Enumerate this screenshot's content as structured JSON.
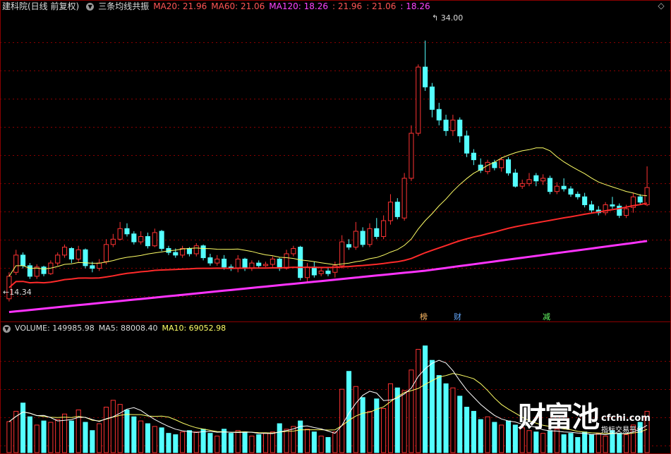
{
  "header": {
    "stock": "建科院(日线 前复权)",
    "indicator": "三条均线共振",
    "ma20": "MA20: 21.96",
    "ma60": "MA60: 21.06",
    "ma120": "MA120: 18.26",
    "v1": ": 21.96",
    "v2": ": 21.06",
    "v3": ": 18.26",
    "close_glyph": "◇"
  },
  "volume_header": {
    "volume": "VOLUME: 149985.98",
    "ma5": "MA5: 88008.40",
    "ma10": "MA10: 69052.98"
  },
  "labels": {
    "high": "34.00",
    "low": "14.34",
    "tag_bang": "榜",
    "tag_cai": "财",
    "tag_jian": "减"
  },
  "watermark": {
    "brand": "财富池",
    "site": "cfchi.com",
    "slogan": "指标交易平台"
  },
  "colors": {
    "up": "#ff3333",
    "down": "#54ffff",
    "ma20": "#ffff66",
    "ma60": "#ff2a2a",
    "ma120": "#ff33ff",
    "grid": "#8b0000"
  },
  "chart_data": {
    "type": "candlestick",
    "price_axis": {
      "min": 13,
      "max": 36
    },
    "annotations": {
      "max": 34.0,
      "min": 14.34
    },
    "candles": [
      [
        14.5,
        16.2,
        16.5,
        14.3
      ],
      [
        16.5,
        17.8,
        18.2,
        16.3
      ],
      [
        17.8,
        17.0,
        18.0,
        16.8
      ],
      [
        17.0,
        16.2,
        17.2,
        16.0
      ],
      [
        16.2,
        16.9,
        17.1,
        16.0
      ],
      [
        16.9,
        16.4,
        17.0,
        16.2
      ],
      [
        16.4,
        17.2,
        17.4,
        16.3
      ],
      [
        17.2,
        17.8,
        18.0,
        17.0
      ],
      [
        17.8,
        18.4,
        18.6,
        17.6
      ],
      [
        18.3,
        17.5,
        18.4,
        17.2
      ],
      [
        17.5,
        18.2,
        18.5,
        17.3
      ],
      [
        18.2,
        17.0,
        18.3,
        16.8
      ],
      [
        17.0,
        16.8,
        17.3,
        16.5
      ],
      [
        16.8,
        17.2,
        17.5,
        16.6
      ],
      [
        17.3,
        18.6,
        19.0,
        17.1
      ],
      [
        18.6,
        19.0,
        19.4,
        18.4
      ],
      [
        19.0,
        19.8,
        20.3,
        18.9
      ],
      [
        19.8,
        19.4,
        20.2,
        19.2
      ],
      [
        19.4,
        18.8,
        19.6,
        18.6
      ],
      [
        18.8,
        19.2,
        19.6,
        18.6
      ],
      [
        19.2,
        18.5,
        19.5,
        18.3
      ],
      [
        18.5,
        19.5,
        19.8,
        18.4
      ],
      [
        19.6,
        18.3,
        19.7,
        18.1
      ],
      [
        18.3,
        18.0,
        18.5,
        17.8
      ],
      [
        18.0,
        17.8,
        18.3,
        17.6
      ],
      [
        17.8,
        18.3,
        18.5,
        17.6
      ],
      [
        18.3,
        17.9,
        18.4,
        17.7
      ],
      [
        17.9,
        18.5,
        18.7,
        17.7
      ],
      [
        18.5,
        17.6,
        18.6,
        17.4
      ],
      [
        17.6,
        17.2,
        17.9,
        17.0
      ],
      [
        17.2,
        17.5,
        17.8,
        17.0
      ],
      [
        17.5,
        16.9,
        17.8,
        16.7
      ],
      [
        16.9,
        16.8,
        17.1,
        16.6
      ],
      [
        16.8,
        17.5,
        17.8,
        16.5
      ],
      [
        17.5,
        16.8,
        17.6,
        16.6
      ],
      [
        16.8,
        17.2,
        17.4,
        16.6
      ],
      [
        17.2,
        17.0,
        17.4,
        16.8
      ],
      [
        17.0,
        17.1,
        17.3,
        16.9
      ],
      [
        17.1,
        17.5,
        17.7,
        16.9
      ],
      [
        17.5,
        16.8,
        17.6,
        16.6
      ],
      [
        16.8,
        17.9,
        18.2,
        16.7
      ],
      [
        17.9,
        18.3,
        18.5,
        17.7
      ],
      [
        18.4,
        16.1,
        18.5,
        15.9
      ],
      [
        16.1,
        16.9,
        17.2,
        15.8
      ],
      [
        16.9,
        16.3,
        17.3,
        16.1
      ],
      [
        16.4,
        16.6,
        16.9,
        16.2
      ],
      [
        16.6,
        16.4,
        16.9,
        16.2
      ],
      [
        16.5,
        17.0,
        17.3,
        16.1
      ],
      [
        17.0,
        18.8,
        19.3,
        16.8
      ],
      [
        18.6,
        18.4,
        19.0,
        18.2
      ],
      [
        18.4,
        19.6,
        20.3,
        18.2
      ],
      [
        19.6,
        18.6,
        19.9,
        18.4
      ],
      [
        18.6,
        19.8,
        20.2,
        18.4
      ],
      [
        19.8,
        19.2,
        20.6,
        19.0
      ],
      [
        19.2,
        20.4,
        20.8,
        19.0
      ],
      [
        20.4,
        21.8,
        22.4,
        20.1
      ],
      [
        21.8,
        20.7,
        22.1,
        20.5
      ],
      [
        20.6,
        23.6,
        24.0,
        20.4
      ],
      [
        23.6,
        27.0,
        27.6,
        23.4
      ],
      [
        27.0,
        32.0,
        32.2,
        26.8
      ],
      [
        32.0,
        30.5,
        34.0,
        30.2
      ],
      [
        30.5,
        28.8,
        30.8,
        28.2
      ],
      [
        28.8,
        28.0,
        29.3,
        27.6
      ],
      [
        28.0,
        27.2,
        28.4,
        26.8
      ],
      [
        27.2,
        28.0,
        28.4,
        26.8
      ],
      [
        28.0,
        26.8,
        28.2,
        26.3
      ],
      [
        26.8,
        25.5,
        27.2,
        25.2
      ],
      [
        25.5,
        25.0,
        25.8,
        24.6
      ],
      [
        24.6,
        24.2,
        25.1,
        24.0
      ],
      [
        24.1,
        24.8,
        25.0,
        23.9
      ],
      [
        24.8,
        24.4,
        25.0,
        24.2
      ],
      [
        24.4,
        25.0,
        25.2,
        24.1
      ],
      [
        25.0,
        24.0,
        25.2,
        23.8
      ],
      [
        24.0,
        23.0,
        24.3,
        22.9
      ],
      [
        23.0,
        23.2,
        23.5,
        22.8
      ],
      [
        23.2,
        23.5,
        24.0,
        23.0
      ],
      [
        23.8,
        23.4,
        24.0,
        23.0
      ],
      [
        23.4,
        23.6,
        23.9,
        23.1
      ],
      [
        23.6,
        22.6,
        23.8,
        22.4
      ],
      [
        22.6,
        23.0,
        23.3,
        22.4
      ],
      [
        23.0,
        22.8,
        23.6,
        22.6
      ],
      [
        22.8,
        22.4,
        23.0,
        22.2
      ],
      [
        22.4,
        22.2,
        22.6,
        22.0
      ],
      [
        22.2,
        21.6,
        22.5,
        21.4
      ],
      [
        21.6,
        21.2,
        21.9,
        21.0
      ],
      [
        21.2,
        21.0,
        21.5,
        20.8
      ],
      [
        21.0,
        21.6,
        21.8,
        20.8
      ],
      [
        21.6,
        21.5,
        22.2,
        21.3
      ],
      [
        21.5,
        20.8,
        21.7,
        20.6
      ],
      [
        20.8,
        21.3,
        21.6,
        20.6
      ],
      [
        21.4,
        22.2,
        22.5,
        21.0
      ],
      [
        22.2,
        21.8,
        22.4,
        21.6
      ],
      [
        21.6,
        22.9,
        24.5,
        21.5
      ]
    ],
    "volume_axis": {
      "max": 170000
    },
    "volumes": [
      [
        45000,
        1
      ],
      [
        60000,
        1
      ],
      [
        72000,
        0
      ],
      [
        52000,
        0
      ],
      [
        40000,
        1
      ],
      [
        46000,
        0
      ],
      [
        44000,
        1
      ],
      [
        48000,
        1
      ],
      [
        56000,
        1
      ],
      [
        46000,
        0
      ],
      [
        62000,
        1
      ],
      [
        44000,
        0
      ],
      [
        32000,
        0
      ],
      [
        42000,
        1
      ],
      [
        66000,
        1
      ],
      [
        76000,
        1
      ],
      [
        70000,
        1
      ],
      [
        62000,
        0
      ],
      [
        52000,
        0
      ],
      [
        46000,
        1
      ],
      [
        42000,
        0
      ],
      [
        38000,
        1
      ],
      [
        36000,
        0
      ],
      [
        28000,
        0
      ],
      [
        26000,
        0
      ],
      [
        30000,
        1
      ],
      [
        32000,
        0
      ],
      [
        30000,
        1
      ],
      [
        34000,
        0
      ],
      [
        28000,
        0
      ],
      [
        24000,
        1
      ],
      [
        34000,
        0
      ],
      [
        28000,
        0
      ],
      [
        32000,
        1
      ],
      [
        30000,
        0
      ],
      [
        24000,
        1
      ],
      [
        26000,
        0
      ],
      [
        28000,
        1
      ],
      [
        30000,
        1
      ],
      [
        42000,
        0
      ],
      [
        34000,
        1
      ],
      [
        38000,
        1
      ],
      [
        46000,
        0
      ],
      [
        34000,
        1
      ],
      [
        30000,
        0
      ],
      [
        24000,
        1
      ],
      [
        22000,
        0
      ],
      [
        30000,
        1
      ],
      [
        92000,
        1
      ],
      [
        118000,
        0
      ],
      [
        96000,
        1
      ],
      [
        80000,
        0
      ],
      [
        60000,
        1
      ],
      [
        78000,
        0
      ],
      [
        64000,
        1
      ],
      [
        100000,
        1
      ],
      [
        94000,
        0
      ],
      [
        90000,
        1
      ],
      [
        120000,
        1
      ],
      [
        150000,
        1
      ],
      [
        155000,
        0
      ],
      [
        134000,
        0
      ],
      [
        112000,
        0
      ],
      [
        100000,
        0
      ],
      [
        94000,
        1
      ],
      [
        82000,
        0
      ],
      [
        66000,
        0
      ],
      [
        60000,
        0
      ],
      [
        48000,
        0
      ],
      [
        52000,
        1
      ],
      [
        44000,
        0
      ],
      [
        40000,
        1
      ],
      [
        46000,
        0
      ],
      [
        40000,
        0
      ],
      [
        36000,
        1
      ],
      [
        32000,
        1
      ],
      [
        30000,
        0
      ],
      [
        28000,
        1
      ],
      [
        32000,
        0
      ],
      [
        34000,
        1
      ],
      [
        26000,
        0
      ],
      [
        28000,
        0
      ],
      [
        22000,
        0
      ],
      [
        30000,
        0
      ],
      [
        26000,
        0
      ],
      [
        28000,
        1
      ],
      [
        24000,
        1
      ],
      [
        32000,
        0
      ],
      [
        28000,
        0
      ],
      [
        26000,
        1
      ],
      [
        40000,
        1
      ],
      [
        44000,
        0
      ],
      [
        60000,
        1
      ]
    ]
  }
}
